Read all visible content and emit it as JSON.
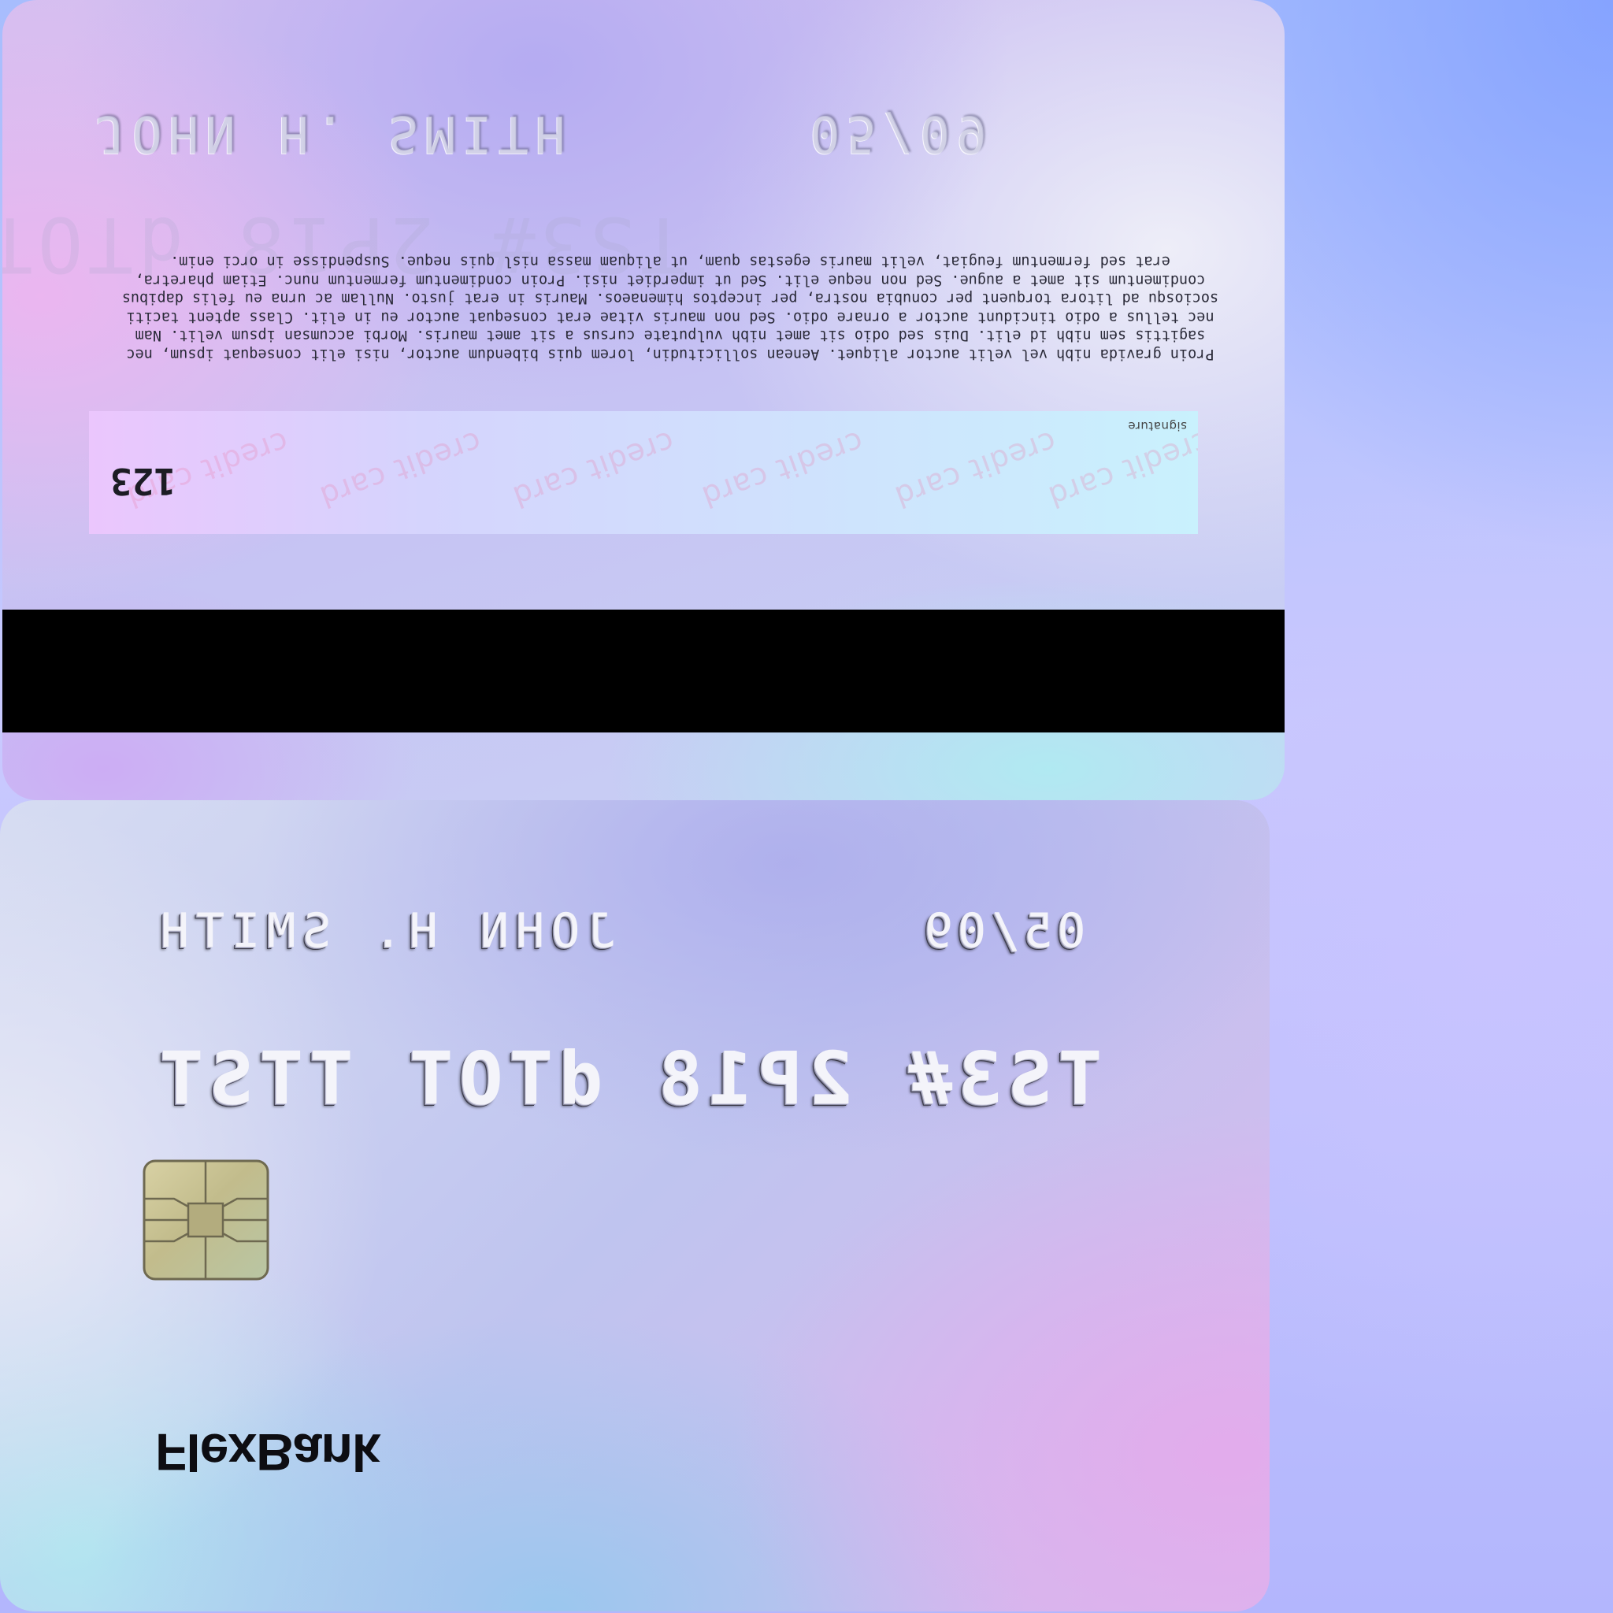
{
  "card": {
    "bank_name": "FlexBank",
    "cardholder_name": "JOHN H. SMITH",
    "expiry": "05/09",
    "card_number": "TS3# 2P18 dTOT TTST",
    "cvv": "123",
    "signature_label": "signature",
    "signature_watermark": "credit card",
    "fine_print": "Proin gravida nibh vel velit auctor aliquet. Aenean sollicitudin, lorem quis bibendum auctor, nisi elit consequat ipsum, nec sagittis sem nibh id elit. Duis sed odio sit amet nibh vulputate cursus a sit amet mauris. Morbi accumsan ipsum velit. Nam nec tellus a odio tincidunt auctor a ornare odio. Sed non mauris vitae erat consequat auctor eu in elit. Class aptent taciti sociosqu ad litora torquent per conubia nostra, per inceptos himenaeos. Mauris in erat justo. Nullam ac urna eu felis dapibus condimentum sit amet a augue. Sed non neque elit. Sed ut imperdiet nisi. Proin condimentum fermentum nunc. Etiam pharetra, erat sed fermentum feugiat, velit mauris egestas quam, ut aliquam massa nisl quis neque. Suspendisse in orci enim."
  },
  "colors": {
    "magnetic_stripe": "#000000",
    "chip_gold": "#c9c396",
    "logo": "#0d0d12"
  },
  "icons": [
    "emv-chip-icon"
  ]
}
